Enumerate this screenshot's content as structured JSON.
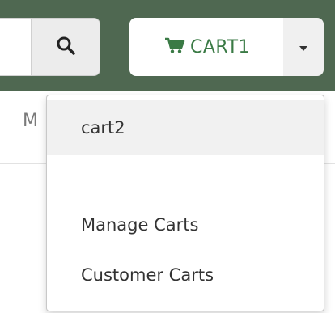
{
  "header": {
    "search": {
      "value": "",
      "icon": "search-icon"
    },
    "cart": {
      "label": "CART1",
      "icon": "cart-icon",
      "caret_icon": "caret-down-icon"
    }
  },
  "nav": {
    "partial_label": "M"
  },
  "cart_menu": {
    "items": [
      {
        "label": "cart2"
      },
      {
        "label": "Manage Carts"
      },
      {
        "label": "Customer Carts"
      }
    ]
  },
  "colors": {
    "header_bg": "#4f6851",
    "cart_accent": "#3a7a45"
  }
}
